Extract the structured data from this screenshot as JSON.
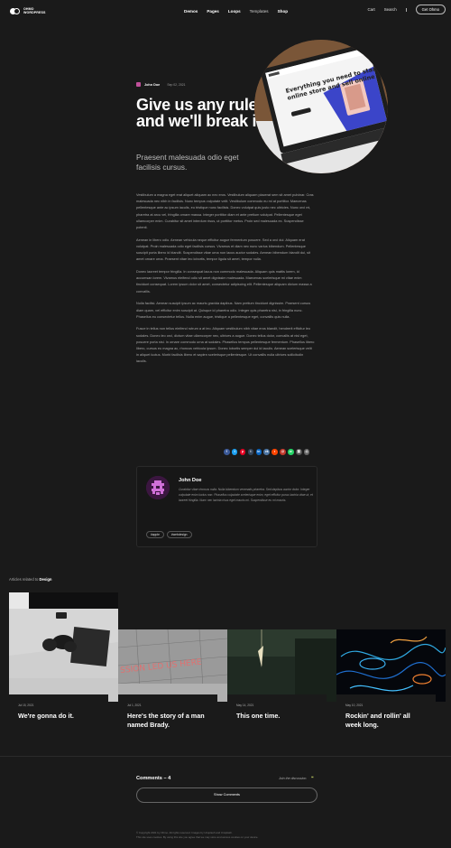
{
  "header": {
    "logo_line1": "OHMO",
    "logo_line2": "WORDPRESS",
    "nav": [
      {
        "label": "Demos",
        "dim": false
      },
      {
        "label": "Pages",
        "dim": false
      },
      {
        "label": "Loops",
        "dim": false
      },
      {
        "label": "Templates",
        "dim": true
      },
      {
        "label": "Shop",
        "dim": false
      }
    ],
    "cart": "Cart",
    "search": "Search",
    "cta": "Get Ohmo"
  },
  "hero": {
    "author": "John Doe",
    "date": "Sep 02, 2021",
    "title": "Give us any rule and we'll break it.",
    "subtitle": "Praesent malesuada odio eget facilisis cursus.",
    "screen_text": "Everything you need to start an online store and sell online"
  },
  "body": [
    "Vestibulum a magna eget erat aliquet aliquam ac nec eros. Vestibulum aliquam placerat sem sit amet pulvinar. Cras malesuada nec nibh in facilisis. Nunc tempus vulputate velit. Vestibulum commodo eu mi at porttitor. Maecenas pellentesque ante ac ipsum iaculis, eu tristique nunc facilisis. Donec volutpat quis justo nec ultricies. Nunc orci mi, pharetra at arcu vel, fringilla ornare massa. Integer porttitor diam et ante pretium volutpat. Pellentesque eget ullamcorper enim. Curabitur sit amet interdum risus, ut porttitor metus. Proin sed malesuada ex. Suspendisse potenti.",
    "Aenean in libero odio. Aenean vehicula neque efficitur augue fermentum posuere. Sed a orci dui. Aliquam erat volutpat. Proin malesuada odio eget facilisis cursus. Vivamus et diam nec nunc varius bibendum. Pellentesque suscipit porta libero id blandit. Suspendisse vitae urna non lacus auctor sodales. Aenean bibendum blandit dui, sit amet ornare urna. Praesent vitae leo lobortis, tempor ligula sit amet, tempor nulla.",
    "Donec laoreet tempor fringilla. In consequat lacus non commodo malesuada. Aliquam quis mattis lorem, id accumsan lorem. Vivamus eleifend odio sit amet dignissim malesuada. Maecenas scelerisque mi vitae enim tincidunt consequat. Lorem ipsum dolor sit amet, consectetur adipiscing elit. Pellentesque aliquam dictum massa a convallis.",
    "Nulla facilisi. Aenean suscipit ipsum ac mauris gravida dapibus. Nam pretium tincidunt dignissim. Praesent cursus diam quam, vel efficitur enim suscipit at. Quisque id pharetra odio. Integer quis pharetra nisi, in fringilla nunc. Phasellus eu consectetur tellus. Nulla enim augue, tristique a pellentesque eget, convallis quis nulla.",
    "Fusce in tellus non tellus eleifend rutrum a at leo. Aliquam vestibulum nibh vitae eros blandit, hendrerit efficitur leo sodales. Donec leo orci, dictum vitae ullamcorper nec, ultrices a augue. Donec tellus dolor, convallis at nisl eget, posuere porta nisl. In ornare commodo urna at sodales. Phasellus tempus pellentesque fermentum. Phasellus libero libero, cursus eu magna ac, rhoncus vehicula ipsum. Donec lobortis semper dui id iaculis. Aenean scelerisque velit in aliquet luctus. Morbi facilisis libero et sapien scelerisque pellentesque. Ut convallis nulla ultrices sollicitudin iaculis."
  ],
  "share": [
    {
      "icon": "facebook-icon",
      "glyph": "f",
      "color": "#3b5998"
    },
    {
      "icon": "twitter-icon",
      "glyph": "t",
      "color": "#1da1f2"
    },
    {
      "icon": "pinterest-icon",
      "glyph": "p",
      "color": "#e60023"
    },
    {
      "icon": "tumblr-icon",
      "glyph": "t",
      "color": "#35465c"
    },
    {
      "icon": "linkedin-icon",
      "glyph": "in",
      "color": "#0a66c2"
    },
    {
      "icon": "vk-icon",
      "glyph": "vk",
      "color": "#4c75a3"
    },
    {
      "icon": "reddit-icon",
      "glyph": "r",
      "color": "#ff4500"
    },
    {
      "icon": "email-icon",
      "glyph": "@",
      "color": "#c0392b"
    },
    {
      "icon": "whatsapp-icon",
      "glyph": "w",
      "color": "#25d366"
    },
    {
      "icon": "link-icon",
      "glyph": "⛓",
      "color": "#555555"
    },
    {
      "icon": "print-icon",
      "glyph": "⎙",
      "color": "#666666"
    }
  ],
  "author_card": {
    "name": "John Doe",
    "bio": "Curabitur vitae rhoncus nulla. Nulla bibendum venenatis pharetra. Sed dapibus auctor dolor. Integer vulputate enim luctus non. Phasellus vulputate scelerisque enim, eget efficitur purus lacinia vitae ut, et laoreet fringilla. Nunc nec lacinia risus eget mauris mi. Suspendisse eu mi mauris.",
    "tags": [
      "#apple",
      "#webdesign"
    ]
  },
  "related": {
    "prefix": "Articles related to",
    "category": "Design",
    "cards": [
      {
        "date": "Jul 15, 2021",
        "title": "We're gonna do it."
      },
      {
        "date": "Jul 1, 2021",
        "title": "Here's the story of a man named Brady."
      },
      {
        "date": "May 14, 2021",
        "title": "This one time."
      },
      {
        "date": "May 10, 2021",
        "title": "Rockin' and rollin' all week long."
      }
    ],
    "sign_text": "SSION LED US HERE"
  },
  "comments": {
    "title": "Comments – 4",
    "join": "Join the discussion.",
    "show_button": "Show Comments"
  },
  "footer": {
    "line1": "© Copyright 2021 by Ohmo. All rights reserved. Images by Unsplash and Unsplash.",
    "line2": "This site uses cookies. By using this site you agree that we may store and access cookies on your device."
  }
}
